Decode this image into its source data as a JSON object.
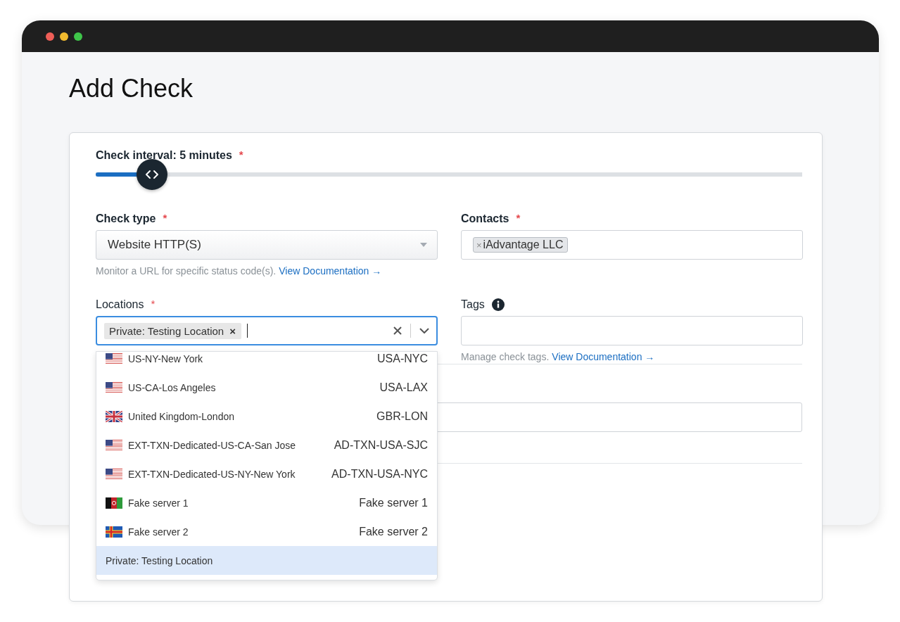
{
  "page": {
    "title": "Add Check"
  },
  "interval": {
    "label": "Check interval: 5 minutes",
    "required_mark": "*",
    "level": 0.08
  },
  "check_type": {
    "label": "Check type",
    "required_mark": "*",
    "value": "Website HTTP(S)",
    "help": "Monitor a URL for specific status code(s).",
    "link": "View Documentation →"
  },
  "contacts": {
    "label": "Contacts",
    "required_mark": "*",
    "chips": [
      {
        "remove": "×",
        "label": "iAdvantage LLC"
      }
    ]
  },
  "locations": {
    "label": "Locations",
    "required_mark": "*",
    "chips": [
      {
        "label": "Private: Testing Location",
        "remove": "×"
      }
    ],
    "options": [
      {
        "kind": "us",
        "name": "US-NY-New York",
        "code": "USA-NYC",
        "selected": false
      },
      {
        "kind": "us",
        "name": "US-CA-Los Angeles",
        "code": "USA-LAX",
        "selected": false
      },
      {
        "kind": "gb",
        "name": "United Kingdom-London",
        "code": "GBR-LON",
        "selected": false
      },
      {
        "kind": "us",
        "name": "EXT-TXN-Dedicated-US-CA-San Jose",
        "code": "AD-TXN-USA-SJC",
        "selected": false
      },
      {
        "kind": "us",
        "name": "EXT-TXN-Dedicated-US-NY-New York",
        "code": "AD-TXN-USA-NYC",
        "selected": false
      },
      {
        "kind": "af",
        "name": "Fake server 1",
        "code": "Fake server 1",
        "selected": false
      },
      {
        "kind": "ax",
        "name": "Fake server 2",
        "code": "Fake server 2",
        "selected": false
      },
      {
        "kind": "private",
        "name": "Private: Testing Location",
        "selected": true
      }
    ]
  },
  "tags": {
    "label": "Tags",
    "help": "Manage check tags.",
    "link": "View Documentation →"
  }
}
